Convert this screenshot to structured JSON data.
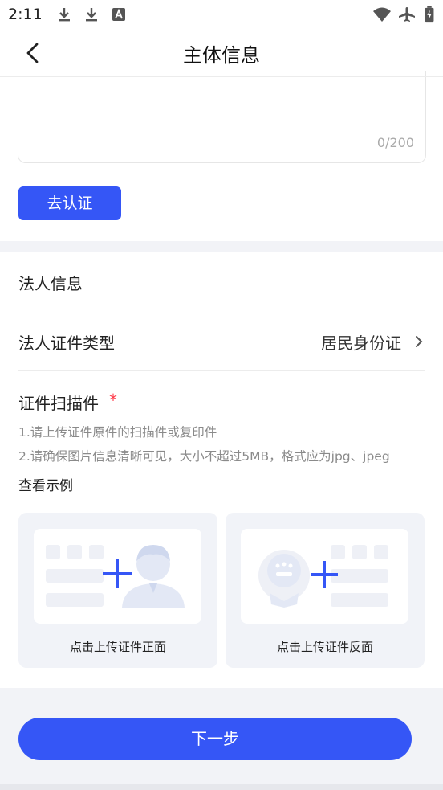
{
  "status_bar": {
    "time": "2:11",
    "left_icons": [
      "download-icon",
      "download-icon",
      "font-icon"
    ],
    "right_icons": [
      "wifi-icon",
      "airplane-icon",
      "battery-charging-icon"
    ]
  },
  "header": {
    "title": "主体信息",
    "back_icon": "chevron-left-icon"
  },
  "textarea": {
    "counter": "0/200"
  },
  "verify_button": "去认证",
  "legal_person": {
    "section_title": "法人信息",
    "id_type_label": "法人证件类型",
    "id_type_value": "居民身份证",
    "scan_title": "证件扫描件",
    "required_mark": "*",
    "hints": [
      "1.请上传证件原件的扫描件或复印件",
      "2.请确保图片信息清晰可见，大小不超过5MB，格式应为jpg、jpeg"
    ],
    "example_link": "查看示例",
    "upload_cards": [
      {
        "label": "点击上传证件正面"
      },
      {
        "label": "点击上传证件反面"
      }
    ]
  },
  "next_button": "下一步",
  "colors": {
    "accent": "#3556f6",
    "required": "#ff3b4a",
    "section_bg": "#f2f3f7"
  }
}
